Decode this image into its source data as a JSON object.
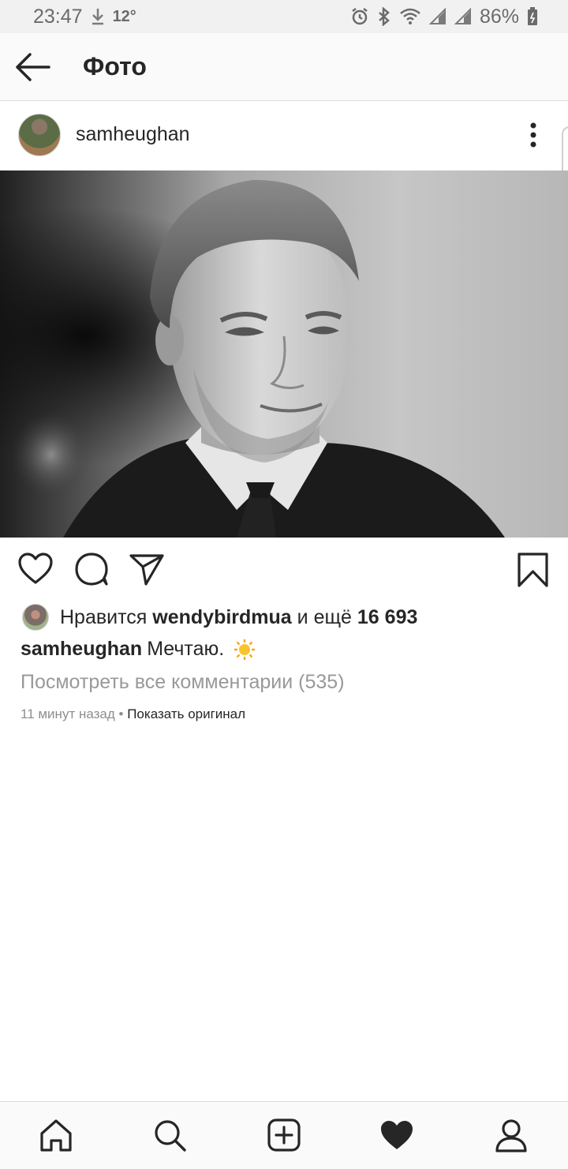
{
  "status_bar": {
    "time": "23:47",
    "temperature": "12°",
    "battery": "86%"
  },
  "header": {
    "title": "Фото",
    "back_icon": "arrow-left-icon"
  },
  "post": {
    "username": "samheughan",
    "more_icon": "vertical-dots-icon",
    "likes": {
      "prefix": "Нравится",
      "liker": "wendybirdmua",
      "middle": "и ещё",
      "count": "16 693"
    },
    "caption": {
      "user": "samheughan",
      "text": "Мечтаю.",
      "emoji_icon": "sun-emoji-icon"
    },
    "view_comments": "Посмотреть все комментарии (535)",
    "time_ago": "11 минут назад",
    "separator": "•",
    "show_original": "Показать оригинал"
  },
  "actions": {
    "like_icon": "heart-outline-icon",
    "comment_icon": "comment-bubble-icon",
    "share_icon": "paper-plane-icon",
    "save_icon": "bookmark-icon"
  },
  "bottom_nav": [
    "home-icon",
    "search-icon",
    "add-post-icon",
    "heart-filled-icon",
    "profile-icon"
  ],
  "colors": {
    "text": "#262626",
    "secondary": "#999999",
    "status_bg": "#f1f1f1",
    "bar_bg": "#fafafa"
  }
}
